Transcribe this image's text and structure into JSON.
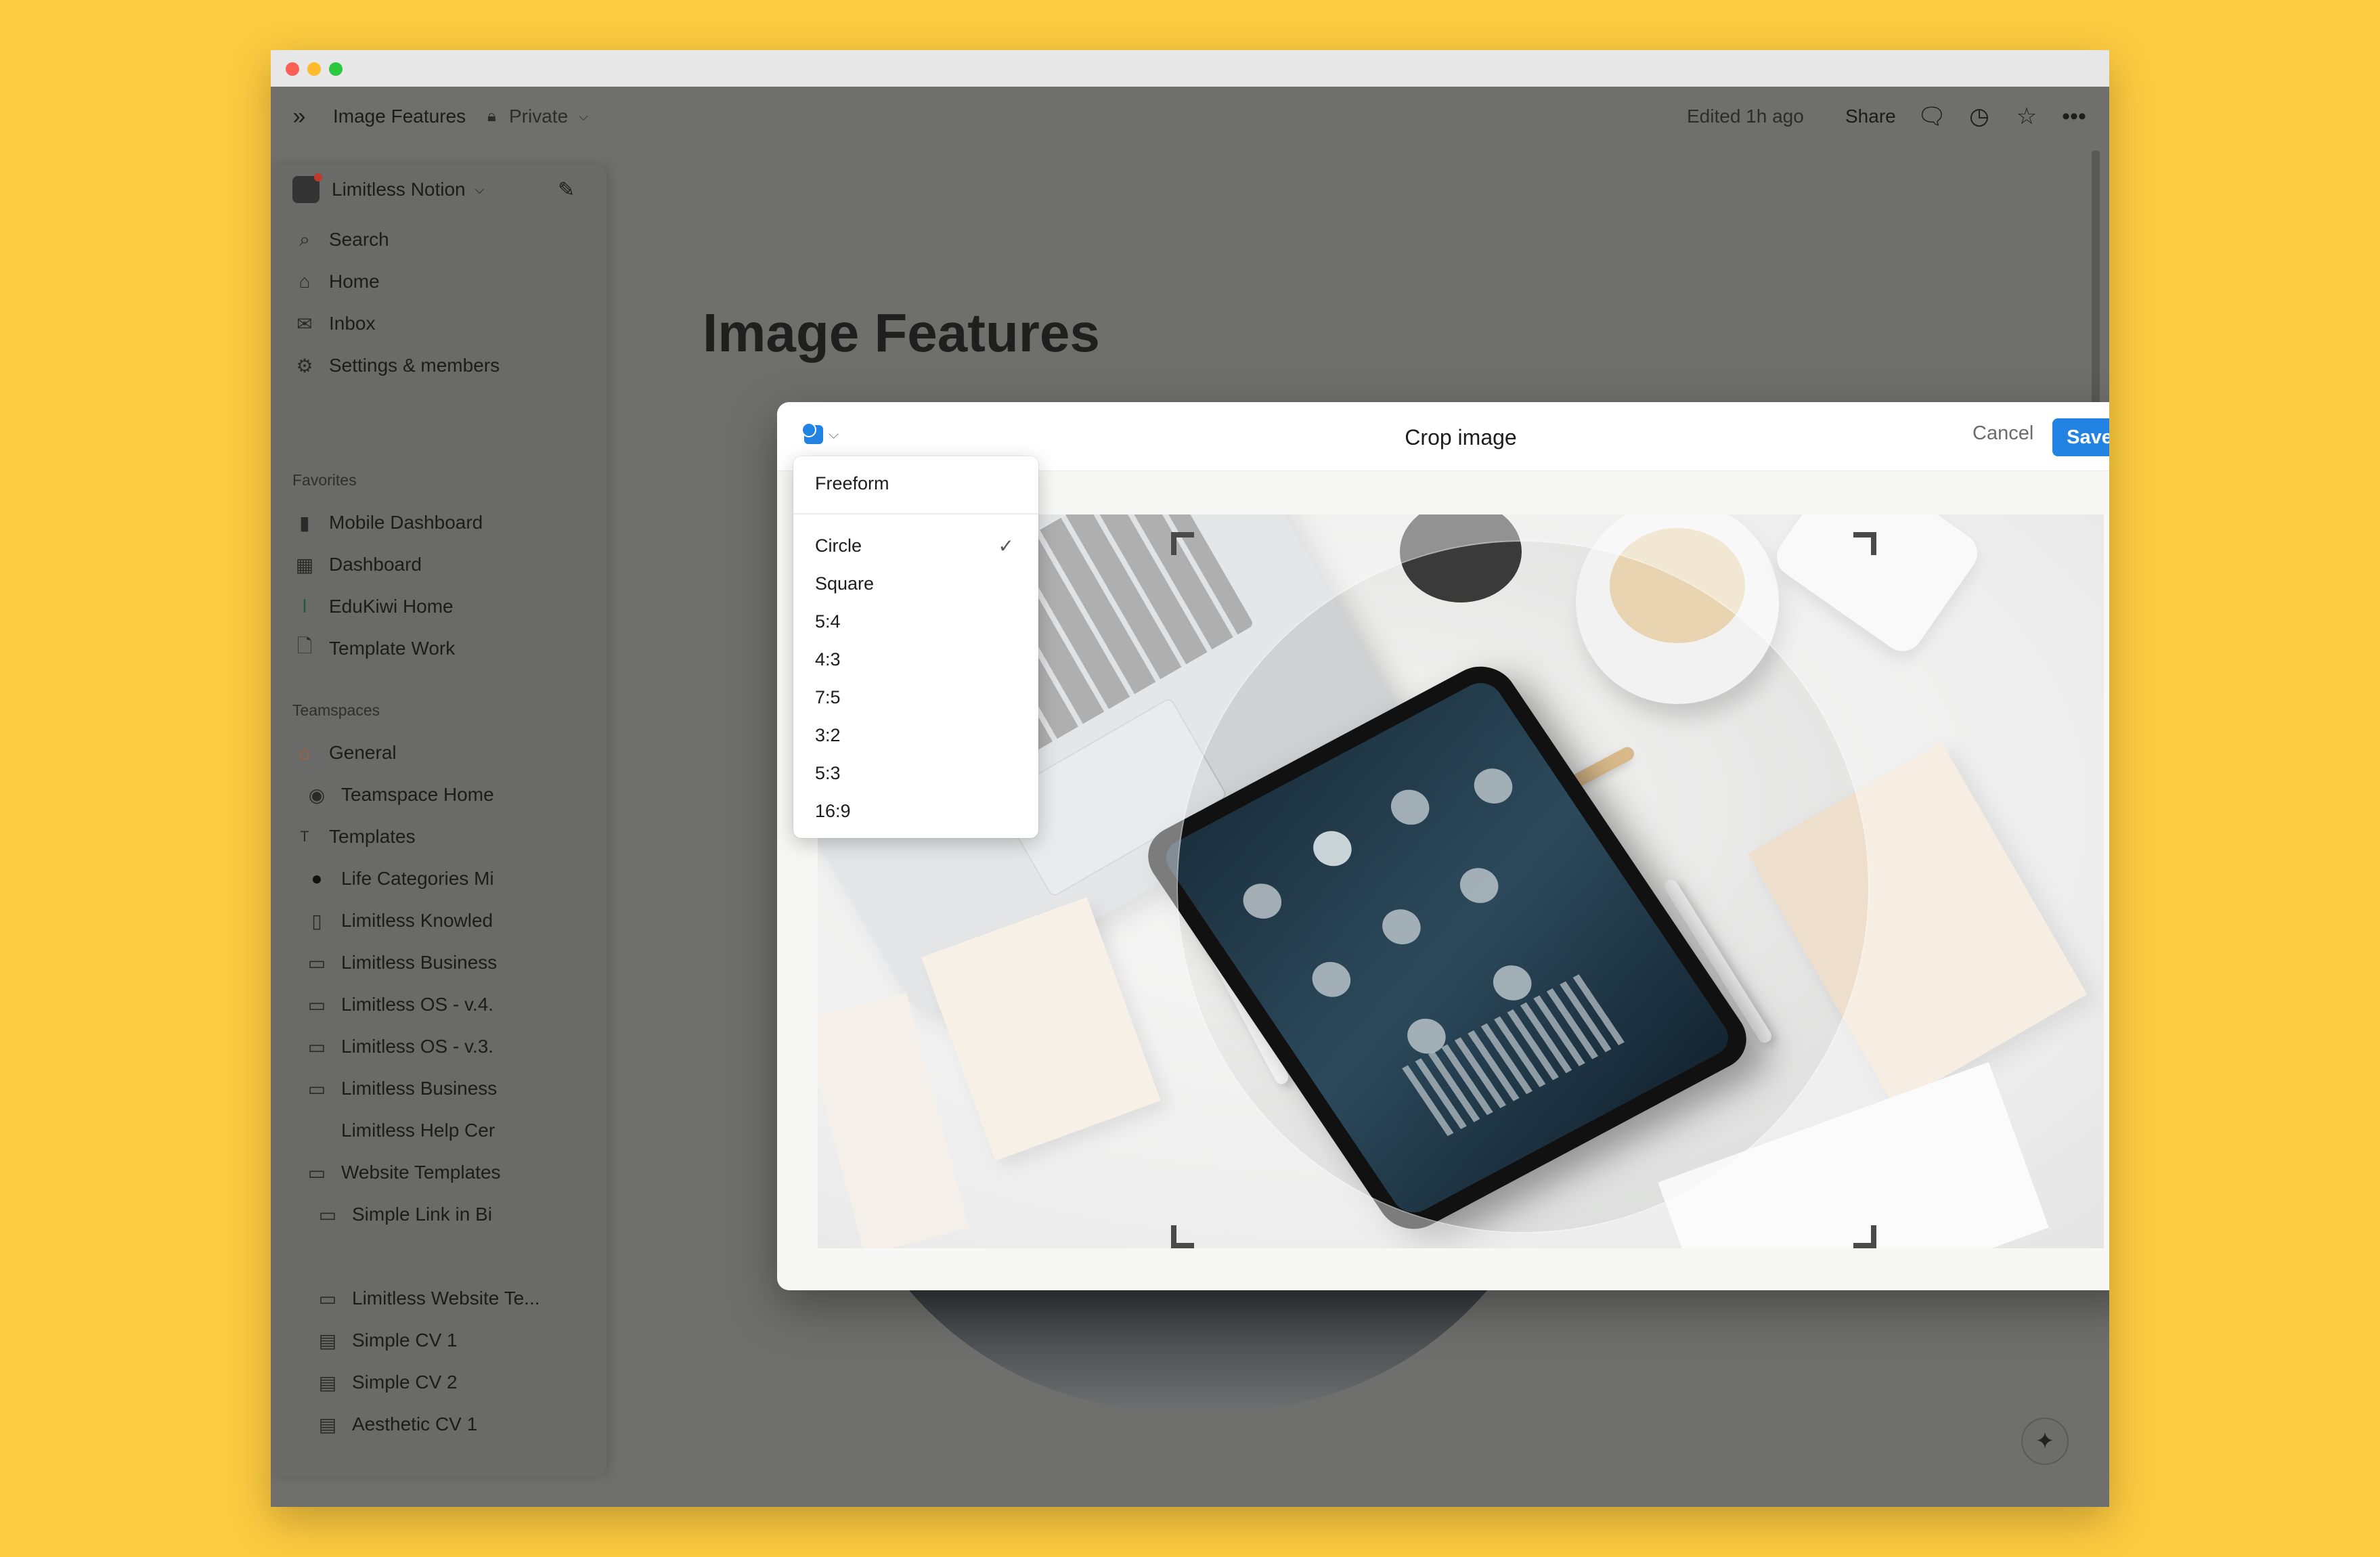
{
  "window": {
    "breadcrumb_title": "Image Features",
    "privacy_label": "Private",
    "edited_label": "Edited 1h ago",
    "share_label": "Share"
  },
  "sidebar": {
    "workspace_name": "Limitless Notion",
    "nav": [
      {
        "label": "Search",
        "icon": "search-icon"
      },
      {
        "label": "Home",
        "icon": "home-icon"
      },
      {
        "label": "Inbox",
        "icon": "inbox-icon"
      },
      {
        "label": "Settings & members",
        "icon": "gear-icon"
      }
    ],
    "favorites_heading": "Favorites",
    "favorites": [
      {
        "label": "Mobile Dashboard"
      },
      {
        "label": "Dashboard"
      },
      {
        "label": "EduKiwi Home"
      },
      {
        "label": "Template Work"
      }
    ],
    "teamspaces_heading": "Teamspaces",
    "teamspaces": [
      {
        "label": "General"
      },
      {
        "label": "Teamspace Home"
      },
      {
        "label": "Templates"
      },
      {
        "label": "Life Categories Mi"
      },
      {
        "label": "Limitless Knowled"
      },
      {
        "label": "Limitless Business"
      },
      {
        "label": "Limitless OS - v.4."
      },
      {
        "label": "Limitless OS - v.3."
      },
      {
        "label": "Limitless Business"
      },
      {
        "label": "Limitless Help Cer"
      },
      {
        "label": "Website Templates"
      },
      {
        "label": "Simple Link in Bi"
      },
      {
        "label": "Limitless Website Te..."
      },
      {
        "label": "Simple CV 1"
      },
      {
        "label": "Simple CV 2"
      },
      {
        "label": "Aesthetic CV 1"
      }
    ]
  },
  "page": {
    "title": "Image Features"
  },
  "dialog": {
    "title": "Crop image",
    "cancel_label": "Cancel",
    "save_label": "Save"
  },
  "dropdown": {
    "freeform_label": "Freeform",
    "options": [
      "Circle",
      "Square",
      "5:4",
      "4:3",
      "7:5",
      "3:2",
      "5:3",
      "16:9"
    ],
    "selected": "Circle",
    "check_mark": "✓"
  },
  "colors": {
    "accent": "#2383e2",
    "background": "#FECC41"
  }
}
